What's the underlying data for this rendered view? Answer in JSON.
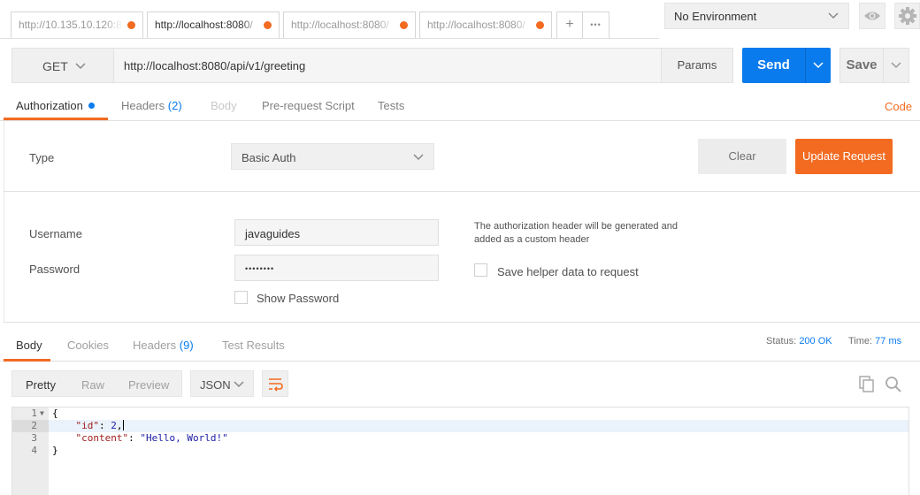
{
  "tabs": [
    {
      "label": "http://10.135.10.120:8"
    },
    {
      "label": "http://localhost:8080/"
    },
    {
      "label": "http://localhost:8080/"
    },
    {
      "label": "http://localhost:8080/"
    }
  ],
  "tab_controls": {
    "add": "+",
    "more": "•••"
  },
  "environment": {
    "selected": "No Environment"
  },
  "request": {
    "method": "GET",
    "url": "http://localhost:8080/api/v1/greeting",
    "params_label": "Params",
    "send_label": "Send",
    "save_label": "Save"
  },
  "request_tabs": {
    "authorization": "Authorization",
    "headers": "Headers",
    "headers_count": "(2)",
    "body": "Body",
    "prerequest": "Pre-request Script",
    "tests": "Tests",
    "code_link": "Code"
  },
  "auth": {
    "type_label": "Type",
    "type_value": "Basic Auth",
    "clear_label": "Clear",
    "update_label": "Update Request",
    "username_label": "Username",
    "username_value": "javaguides",
    "password_label": "Password",
    "password_value": "••••••••",
    "show_password_label": "Show Password",
    "note": "The authorization header will be generated and added as a custom header",
    "save_helper_label": "Save helper data to request"
  },
  "response": {
    "tabs": {
      "body": "Body",
      "cookies": "Cookies",
      "headers": "Headers",
      "headers_count": "(9)",
      "test_results": "Test Results"
    },
    "status_label": "Status:",
    "status_value": "200 OK",
    "time_label": "Time:",
    "time_value": "77 ms",
    "view_modes": {
      "pretty": "Pretty",
      "raw": "Raw",
      "preview": "Preview"
    },
    "format": "JSON",
    "lines": [
      {
        "n": "1",
        "text": "{"
      },
      {
        "n": "2",
        "key": "\"id\"",
        "value": "2"
      },
      {
        "n": "3",
        "key": "\"content\"",
        "value": "\"Hello, World!\""
      },
      {
        "n": "4",
        "text": "}"
      }
    ]
  },
  "colors": {
    "accent": "#f26b21",
    "primary": "#097bed"
  }
}
